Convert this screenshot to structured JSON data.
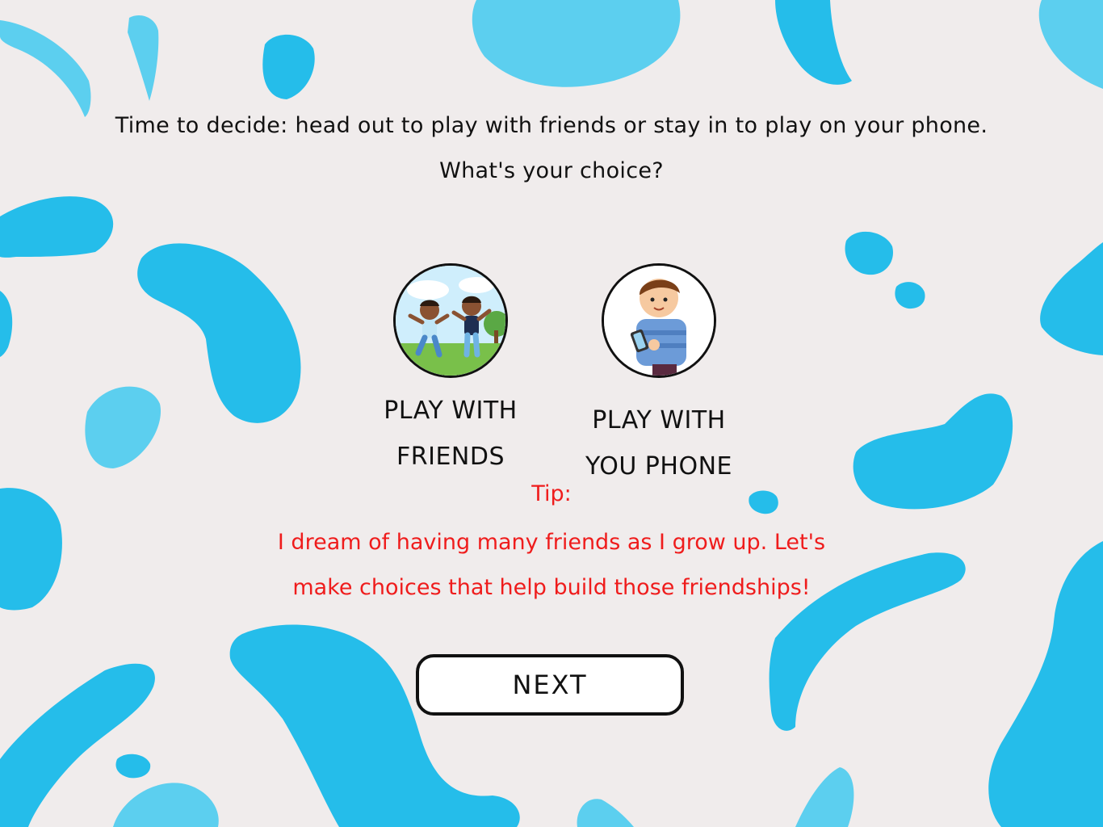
{
  "colors": {
    "background": "#f0ecec",
    "splash_primary": "#25bdea",
    "splash_light": "#5ccfef",
    "tip_text": "#ef1c1c",
    "text": "#111111"
  },
  "prompt": {
    "line1": "Time to decide: head out to play with friends or stay in to play on your phone.",
    "line2": "What's your choice?"
  },
  "options": [
    {
      "label_line1": "PLAY WITH",
      "label_line2": "FRIENDS",
      "icon": "kids-playing-outdoors-icon"
    },
    {
      "label_line1": "PLAY WITH",
      "label_line2": "YOU PHONE",
      "icon": "boy-with-phone-icon"
    }
  ],
  "tip": {
    "title": "Tip:",
    "line1": "I dream of having many friends as I grow up. Let's",
    "line2": "make choices that help build those friendships!"
  },
  "next_button": {
    "label": "NEXT"
  }
}
